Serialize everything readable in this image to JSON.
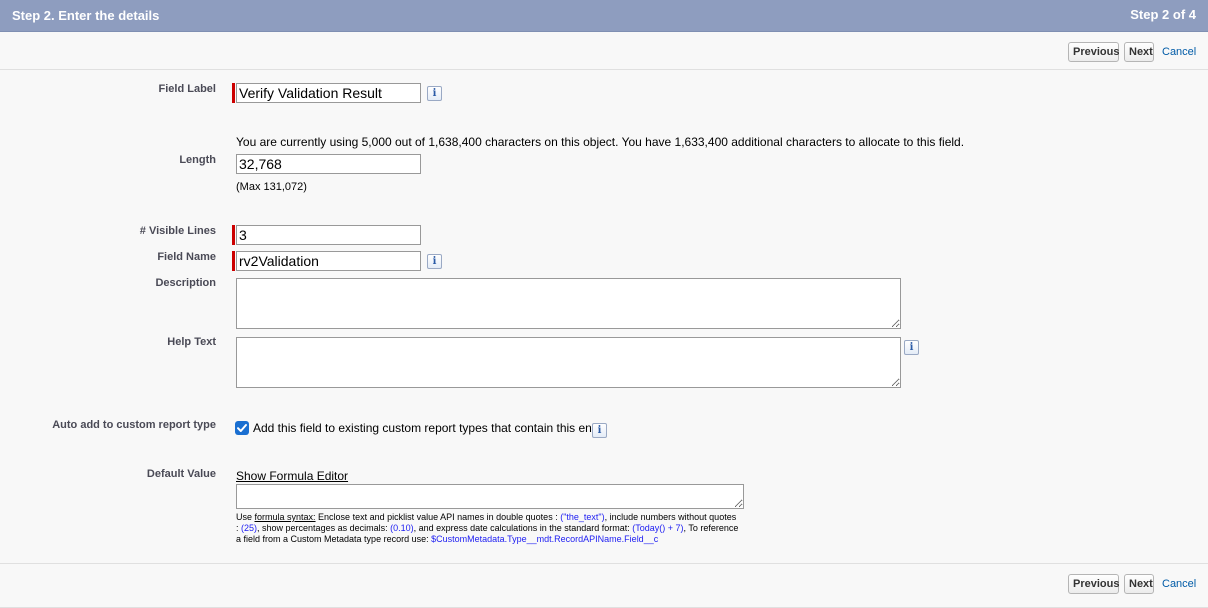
{
  "header": {
    "title": "Step 2. Enter the details",
    "step": "Step 2 of 4"
  },
  "buttons": {
    "previous": "Previous",
    "next": "Next",
    "cancel": "Cancel"
  },
  "fields": {
    "field_label": {
      "label": "Field Label",
      "value": "Verify Validation Result"
    },
    "length": {
      "label": "Length",
      "info": "You are currently using 5,000 out of 1,638,400 characters on this object. You have 1,633,400 additional characters to allocate to this field.",
      "value": "32,768",
      "max": "(Max 131,072)"
    },
    "visible_lines": {
      "label": "# Visible Lines",
      "value": "3"
    },
    "field_name": {
      "label": "Field Name",
      "value": "rv2Validation"
    },
    "description": {
      "label": "Description",
      "value": ""
    },
    "help_text": {
      "label": "Help Text",
      "value": ""
    },
    "auto_add": {
      "label": "Auto add to custom report type",
      "checkbox_label": "Add this field to existing custom report types that contain this entity",
      "checked": true
    },
    "default_value": {
      "label": "Default Value",
      "formula_link": "Show Formula Editor",
      "value": "",
      "hint": {
        "use": "Use ",
        "formula_syntax": "formula syntax:",
        "p1": " Enclose text and picklist value API names in double quotes : ",
        "ex_text": "(\"the_text\")",
        "p2": ", include numbers without quotes",
        "colon": ": ",
        "ex_num": "(25)",
        "p3": ", show percentages as decimals: ",
        "ex_pct": "(0.10)",
        "p4": ", and express date calculations in the standard format: ",
        "ex_date": "(Today() + 7)",
        "p5": ", To reference",
        "p6": "a field from a Custom Metadata type record use: ",
        "ex_meta": "$CustomMetadata.Type__mdt.RecordAPIName.Field__c"
      }
    }
  },
  "icons": {
    "info": "i"
  },
  "colors": {
    "header_bg": "#8e9dbf",
    "required_bar": "#cc0000",
    "link": "#015ba7",
    "checkbox": "#1a6fd1"
  }
}
